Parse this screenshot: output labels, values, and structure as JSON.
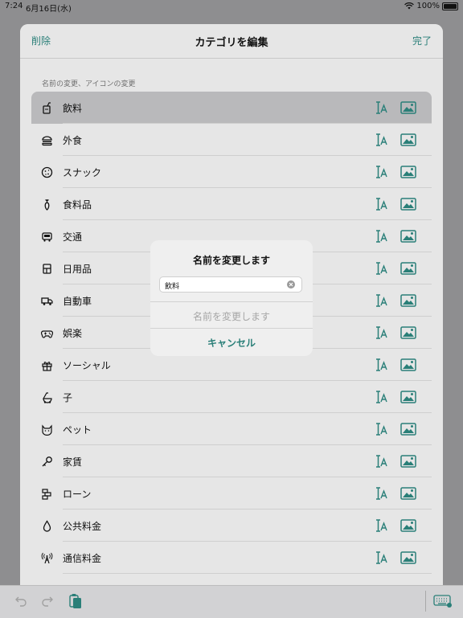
{
  "status": {
    "time": "7:24",
    "date": "6月16日(水)",
    "battery": "100%"
  },
  "nav": {
    "left": "削除",
    "title": "カテゴリを編集",
    "right": "完了"
  },
  "section_header": "名前の変更、アイコンの変更",
  "categories": [
    {
      "label": "飲料",
      "icon": "cup-icon"
    },
    {
      "label": "外食",
      "icon": "burger-icon"
    },
    {
      "label": "スナック",
      "icon": "cookie-icon"
    },
    {
      "label": "食料品",
      "icon": "carrot-icon"
    },
    {
      "label": "交通",
      "icon": "bus-icon"
    },
    {
      "label": "日用品",
      "icon": "household-icon"
    },
    {
      "label": "自動車",
      "icon": "truck-icon"
    },
    {
      "label": "娯楽",
      "icon": "gamepad-icon"
    },
    {
      "label": "ソーシャル",
      "icon": "gift-icon"
    },
    {
      "label": "子",
      "icon": "stroller-icon"
    },
    {
      "label": "ペット",
      "icon": "cat-icon"
    },
    {
      "label": "家賃",
      "icon": "key-icon"
    },
    {
      "label": "ローン",
      "icon": "bricks-icon"
    },
    {
      "label": "公共料金",
      "icon": "drop-icon"
    },
    {
      "label": "通信料金",
      "icon": "antenna-icon"
    }
  ],
  "alert": {
    "title": "名前を変更します",
    "field_value": "飲料",
    "confirm": "名前を変更します",
    "cancel": "キャンセル"
  },
  "colors": {
    "accent": "#2a7f78",
    "disabled": "#a6a6a6"
  }
}
